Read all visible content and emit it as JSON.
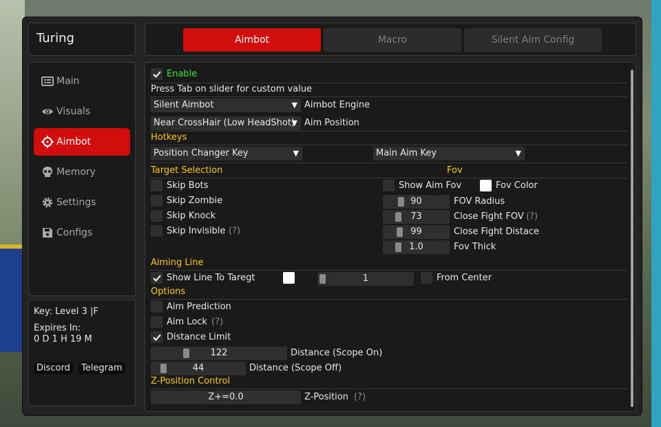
{
  "app": {
    "title": "Turing"
  },
  "sidebar": {
    "items": [
      {
        "label": "Main",
        "icon": "list-icon"
      },
      {
        "label": "Visuals",
        "icon": "eye-icon"
      },
      {
        "label": "Aimbot",
        "icon": "crosshair-icon",
        "active": true
      },
      {
        "label": "Memory",
        "icon": "skull-icon"
      },
      {
        "label": "Settings",
        "icon": "gear-icon"
      },
      {
        "label": "Configs",
        "icon": "floppy-icon"
      }
    ]
  },
  "license": {
    "key_line": "Key: Level 3 |F",
    "expires_label": "Expires In:",
    "expires_value": "0 D 1 H 19 M",
    "discord": "Discord",
    "telegram": "Telegram"
  },
  "tabs": [
    {
      "label": "Aimbot",
      "active": true
    },
    {
      "label": "Macro"
    },
    {
      "label": "Silent Aim Config"
    }
  ],
  "aimbot": {
    "enable": {
      "label": "Enable",
      "checked": true
    },
    "hint": "Press Tab on slider for custom value",
    "engine": {
      "value": "Silent Aimbot",
      "label": "Aimbot Engine"
    },
    "position": {
      "value": "Near CrossHair (Low HeadShot)",
      "label": "Aim Position"
    },
    "hotkeys": {
      "title": "Hotkeys",
      "position_changer": "Position Changer Key",
      "main_aim": "Main Aim Key"
    },
    "target_selection": {
      "title": "Target Selection",
      "skip_bots": {
        "label": "Skip Bots",
        "checked": false
      },
      "skip_zombie": {
        "label": "Skip Zombie",
        "checked": false
      },
      "skip_knock": {
        "label": "Skip Knock",
        "checked": false
      },
      "skip_invisible": {
        "label": "Skip Invisible",
        "checked": false,
        "help": "(?)"
      }
    },
    "fov": {
      "title": "Fov",
      "show_aim_fov": {
        "label": "Show Aim Fov",
        "checked": false
      },
      "fov_color": {
        "label": "Fov Color",
        "color": "#ffffff"
      },
      "fov_radius": {
        "value": "90",
        "label": "FOV Radius"
      },
      "close_fight_fov": {
        "value": "73",
        "label": "Close Fight FOV",
        "help": "(?)"
      },
      "close_fight_distance": {
        "value": "99",
        "label": "Close Fight Distace"
      },
      "fov_thick": {
        "value": "1.0",
        "label": "Fov Thick"
      }
    },
    "aiming_line": {
      "title": "Aiming Line",
      "show_line": {
        "label": "Show Line To Taregt",
        "checked": true
      },
      "line_color": "#ffffff",
      "thickness": "1",
      "from_center": {
        "label": "From Center",
        "checked": false
      }
    },
    "options": {
      "title": "Options",
      "aim_prediction": {
        "label": "Aim Prediction",
        "checked": false
      },
      "aim_lock": {
        "label": "Aim Lock",
        "checked": false,
        "help": "(?)"
      },
      "distance_limit": {
        "label": "Distance Limit",
        "checked": true
      },
      "distance_scope_on": {
        "value": "122",
        "label": "Distance (Scope On)"
      },
      "distance_scope_off": {
        "value": "44",
        "label": "Distance (Scope Off)"
      }
    },
    "z_position": {
      "title": "Z-Position Control",
      "value": "Z+=0.0",
      "label": "Z-Position",
      "help": "(?)"
    }
  },
  "colors": {
    "accent": "#d10d0d",
    "section": "#ffcc00",
    "enable": "#3fe03f"
  }
}
